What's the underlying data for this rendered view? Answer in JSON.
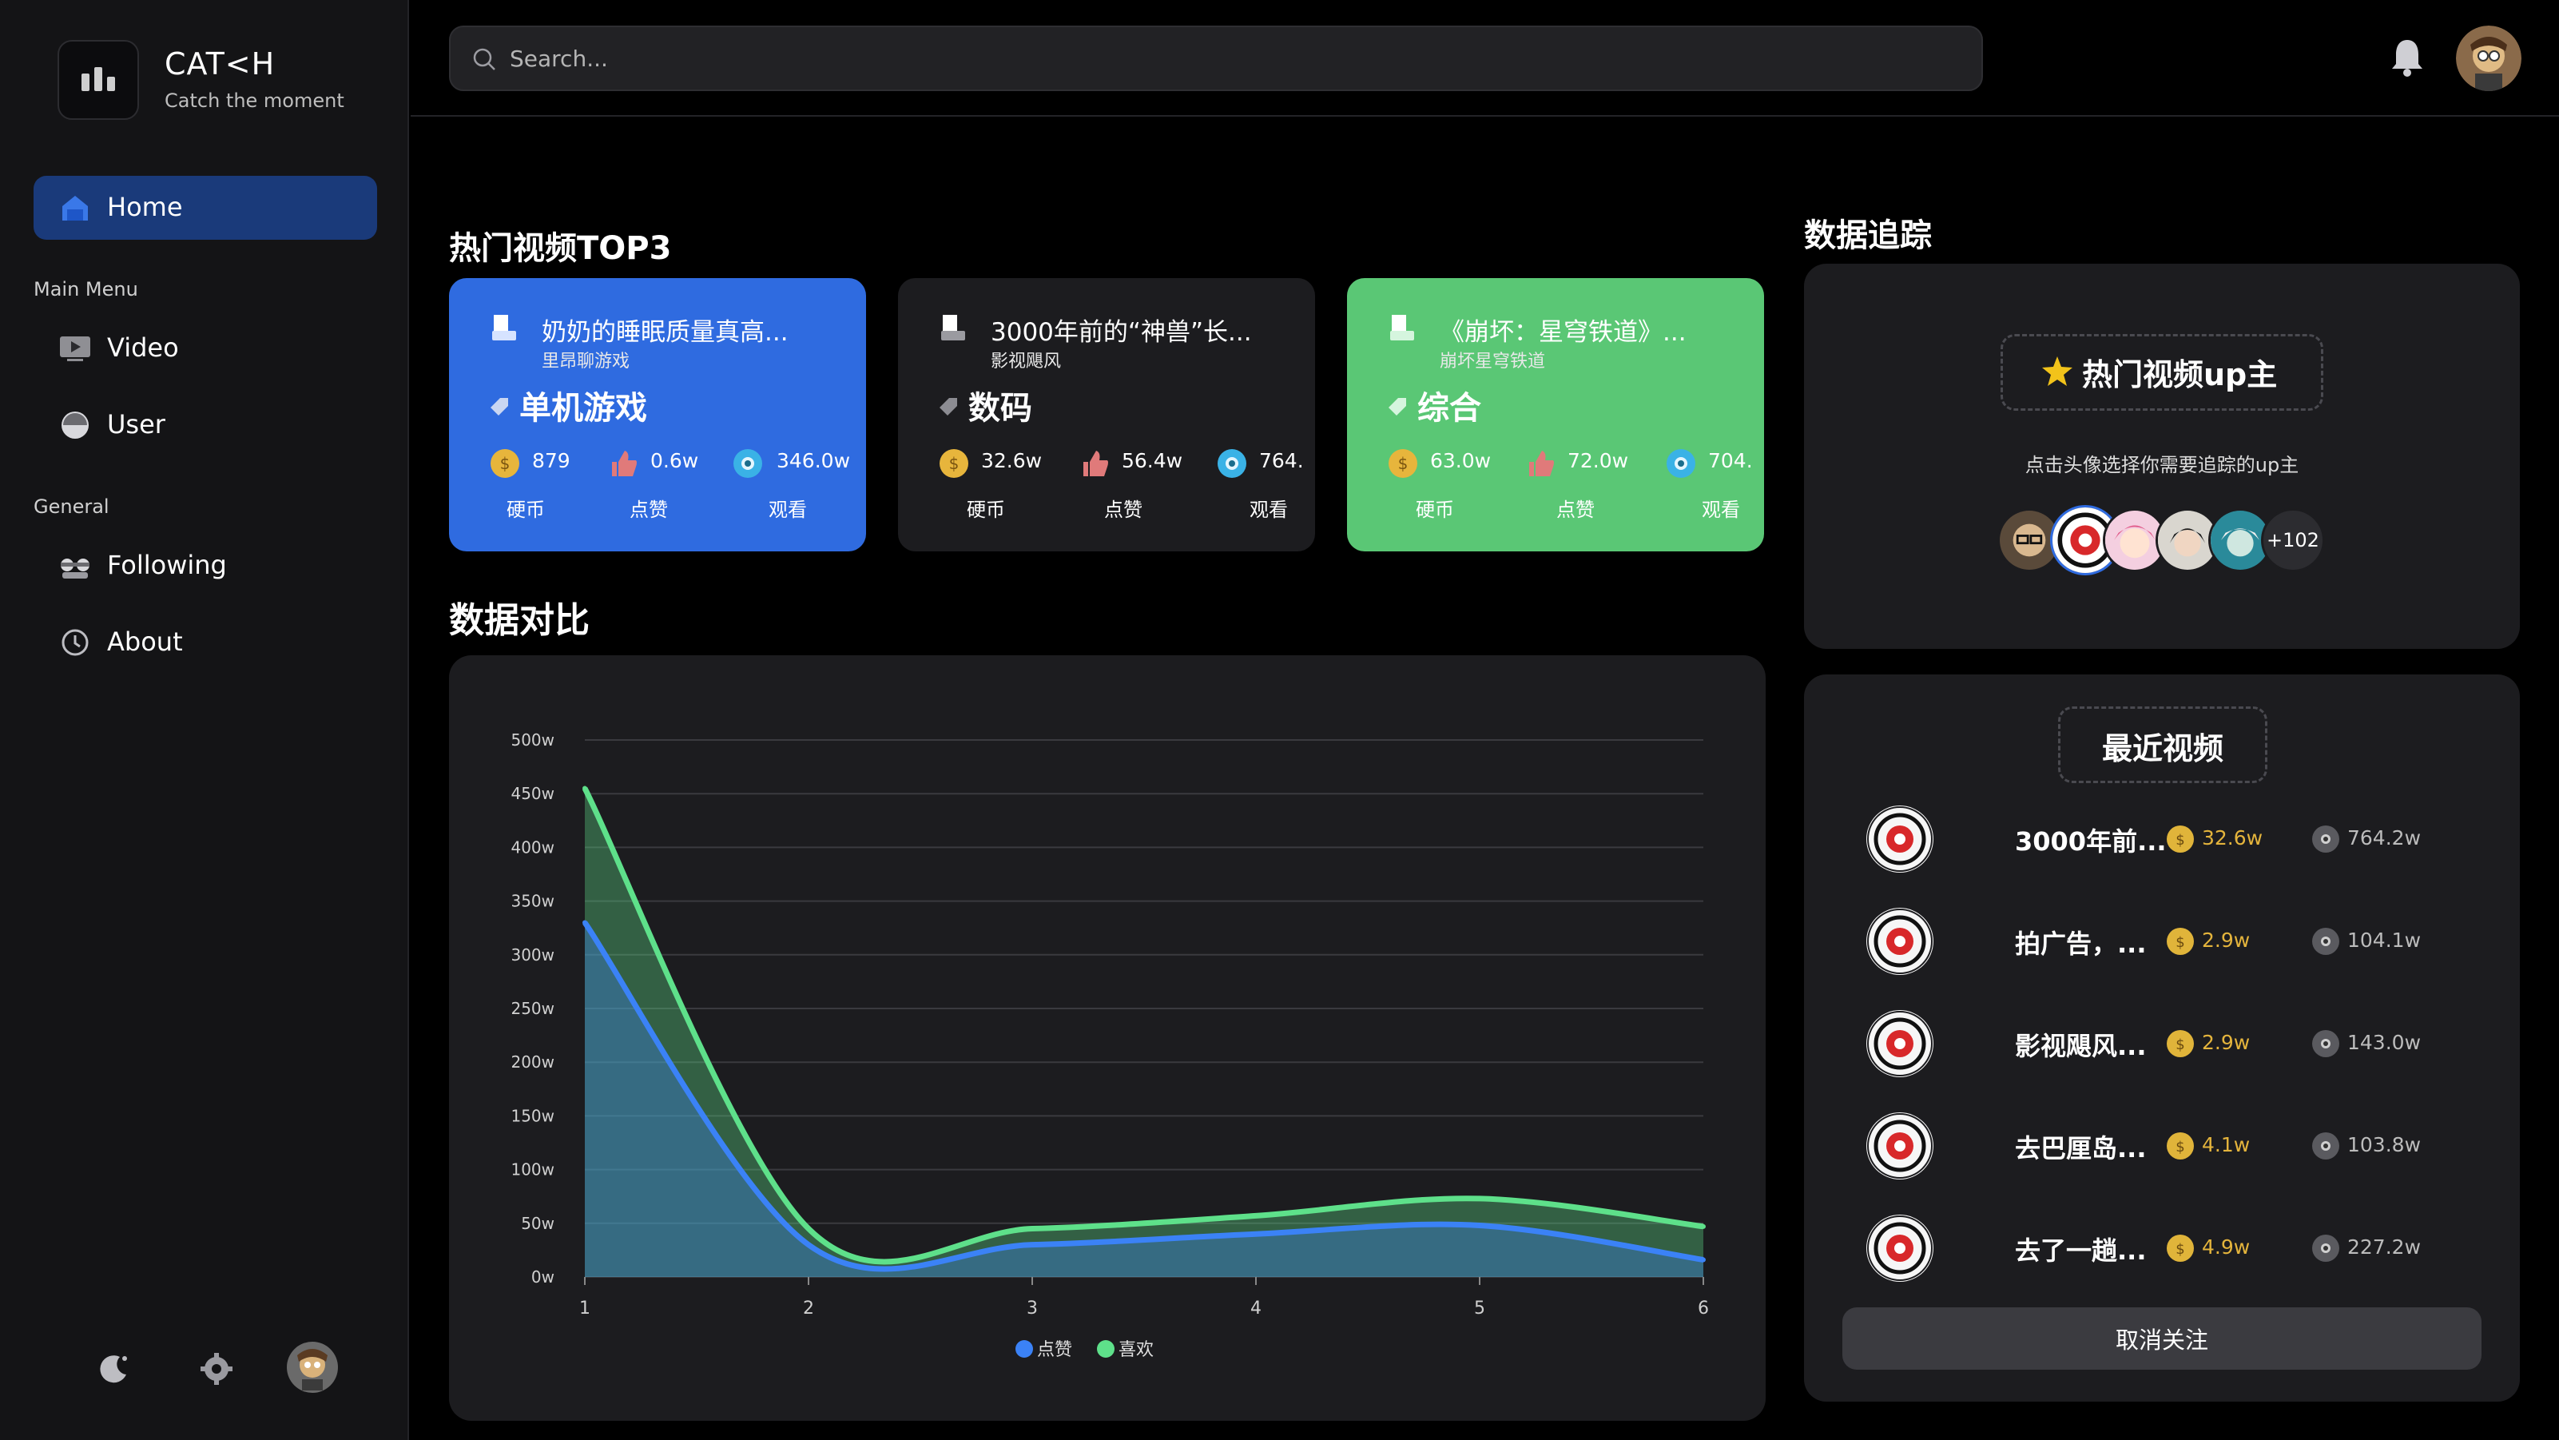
{
  "app": {
    "name": "CAT<H",
    "tagline": "Catch the moment"
  },
  "sidebar": {
    "main_menu_label": "Main Menu",
    "general_label": "General",
    "items": [
      {
        "label": "Home",
        "icon": "home-icon",
        "active": true
      },
      {
        "label": "Video",
        "icon": "video-icon"
      },
      {
        "label": "User",
        "icon": "user-icon"
      },
      {
        "label": "Following",
        "icon": "following-icon"
      },
      {
        "label": "About",
        "icon": "about-icon"
      }
    ],
    "bottom": [
      "theme-toggle-icon",
      "settings-icon",
      "avatar"
    ]
  },
  "header": {
    "search_placeholder": "Search..."
  },
  "top3": {
    "title": "热门视频TOP3",
    "cards": [
      {
        "title": "奶奶的睡眠质量真高...",
        "author": "里昂聊游戏",
        "category": "单机游戏",
        "coins": "879",
        "likes": "0.6w",
        "views": "346.0w",
        "coins_label": "硬币",
        "likes_label": "点赞",
        "views_label": "观看",
        "color": "#2f6be0"
      },
      {
        "title": "3000年前的“神兽”长...",
        "author": "影视飓风",
        "category": "数码",
        "coins": "32.6w",
        "likes": "56.4w",
        "views": "764.",
        "coins_label": "硬币",
        "likes_label": "点赞",
        "views_label": "观看",
        "color": "#1c1c1f"
      },
      {
        "title": "《崩坏：星穹铁道》...",
        "author": "崩坏星穹铁道",
        "category": "综合",
        "coins": "63.0w",
        "likes": "72.0w",
        "views": "704.",
        "coins_label": "硬币",
        "likes_label": "点赞",
        "views_label": "观看",
        "color": "#5ac775"
      }
    ]
  },
  "compare": {
    "title": "数据对比"
  },
  "chart_data": {
    "type": "area",
    "title": "",
    "x": [
      1,
      2,
      3,
      4,
      5,
      6
    ],
    "series": [
      {
        "name": "点赞",
        "color": "#3b82f6",
        "values": [
          330,
          30,
          30,
          40,
          48,
          16
        ]
      },
      {
        "name": "喜欢",
        "color": "#5ee08a",
        "values": [
          455,
          45,
          45,
          57,
          73,
          47
        ]
      }
    ],
    "yticks": [
      "0w",
      "50w",
      "100w",
      "150w",
      "200w",
      "250w",
      "300w",
      "350w",
      "400w",
      "450w",
      "500w"
    ],
    "ylim": [
      0,
      500
    ],
    "grid": true,
    "legend": "bottom"
  },
  "tracking": {
    "title": "数据追踪",
    "hot_up_title": "热门视频up主",
    "hint": "点击头像选择你需要追踪的up主",
    "more_count": "+102"
  },
  "recent": {
    "title": "最近视频",
    "rows": [
      {
        "title": "3000年前...",
        "coins": "32.6w",
        "views": "764.2w"
      },
      {
        "title": "拍广告，...",
        "coins": "2.9w",
        "views": "104.1w"
      },
      {
        "title": "影视飓风...",
        "coins": "2.9w",
        "views": "143.0w"
      },
      {
        "title": "去巴厘岛...",
        "coins": "4.1w",
        "views": "103.8w"
      },
      {
        "title": "去了一趟...",
        "coins": "4.9w",
        "views": "227.2w"
      }
    ],
    "unfollow_label": "取消关注"
  }
}
